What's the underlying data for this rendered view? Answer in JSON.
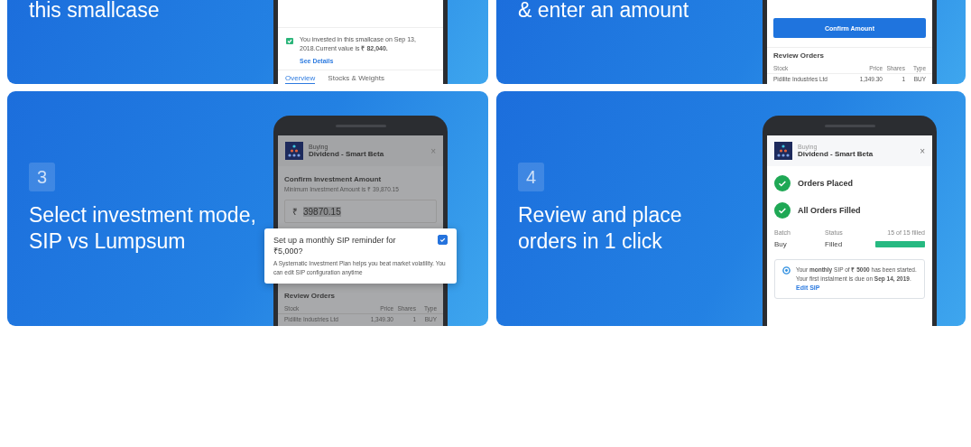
{
  "cards": [
    {
      "title": [
        "this smallcase"
      ],
      "screen": {
        "kind": "holding",
        "notice": "You invested in this smallcase on Sep 13, 2018.Current value is **₹ 82,040.**",
        "link": "See Details",
        "tabs": [
          {
            "label": "Overview",
            "selected": true
          },
          {
            "label": "Stocks & Weights",
            "selected": false
          }
        ]
      }
    },
    {
      "title": [
        "& enter an amount"
      ],
      "screen": {
        "kind": "amount",
        "button": "Confirm Amount",
        "section": "Review Orders",
        "columns": [
          "Stock",
          "Price",
          "Shares",
          "Type"
        ],
        "rows": [
          [
            "Pidilite Industries Ltd",
            "1,349.30",
            "1",
            "BUY"
          ]
        ]
      }
    },
    {
      "step": "3",
      "title": [
        "Select investment mode,",
        "SIP vs Lumpsum"
      ],
      "screen": {
        "kind": "sip",
        "caption": "Buying",
        "name": "Dividend - Smart Beta",
        "close": "×",
        "heading": "Confirm Investment Amount",
        "minimum": "Minimum Investment Amount is ₹ 39,870.15",
        "currency": "₹",
        "amount": "39870.15",
        "popup": {
          "title": "Set up a monthly SIP reminder for ₹5,000?",
          "checked": true,
          "text": "A Systematic Investment Plan helps you beat market volatility. You can edit SIP configuration anytime"
        },
        "section": "Review Orders",
        "columns": [
          "Stock",
          "Price",
          "Shares",
          "Type"
        ],
        "rows": [
          [
            "Pidilite Industries Ltd",
            "1,349.30",
            "1",
            "BUY"
          ]
        ]
      }
    },
    {
      "step": "4",
      "title": [
        "Review and place",
        "orders in 1 click"
      ],
      "screen": {
        "kind": "orders",
        "caption": "Buying",
        "name": "Dividend - Smart Beta",
        "close": "×",
        "statuses": [
          "Orders Placed",
          "All Orders Filled"
        ],
        "fields": [
          {
            "label": "Batch",
            "value": "Buy"
          },
          {
            "label": "Status",
            "value": "Filled"
          }
        ],
        "progress": {
          "label": "15 of 15 filled",
          "level": 1
        },
        "notice": "Your **monthly** SIP of **₹ 5000** has been started. Your first instalment is due on **Sep 14, 2019**.",
        "link": "Edit SIP"
      }
    }
  ]
}
